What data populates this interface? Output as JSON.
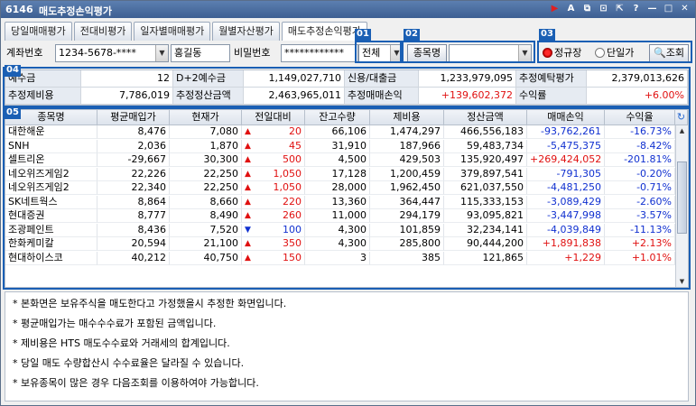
{
  "window": {
    "screen_no": "6146",
    "title": "매도추정손익평가"
  },
  "title_buttons": [
    "play-icon",
    "font-icon",
    "copy-icon",
    "link-icon",
    "export-icon",
    "help-icon",
    "minimize-icon",
    "maximize-icon",
    "close-icon"
  ],
  "tabs": [
    {
      "label": "당일매매평가",
      "active": false
    },
    {
      "label": "전대비평가",
      "active": false
    },
    {
      "label": "일자별매매평가",
      "active": false
    },
    {
      "label": "월별자산평가",
      "active": false
    },
    {
      "label": "매도추정손익평가",
      "active": true
    }
  ],
  "form": {
    "account_label": "계좌번호",
    "account_value": "1234-5678-****",
    "account_name": "홍길동",
    "password_label": "비밀번호",
    "password_value": "************",
    "filter_value": "전체",
    "stock_button": "종목명",
    "stock_value": "",
    "radio_regular": "정규장",
    "radio_single": "단일가",
    "query_button": "조회"
  },
  "badges": [
    "01",
    "02",
    "03",
    "04",
    "05"
  ],
  "summary": {
    "row1": [
      {
        "label": "예수금",
        "value": "12"
      },
      {
        "label": "D+2예수금",
        "value": "1,149,027,710"
      },
      {
        "label": "신용/대출금",
        "value": "1,233,979,095"
      },
      {
        "label": "추정예탁평가",
        "value": "2,379,013,626"
      }
    ],
    "row2": [
      {
        "label": "추정제비용",
        "value": "7,786,019"
      },
      {
        "label": "추정정산금액",
        "value": "2,463,965,011"
      },
      {
        "label": "추정매매손익",
        "value": "+139,602,372"
      },
      {
        "label": "수익률",
        "value": "+6.00%"
      }
    ]
  },
  "table": {
    "headers": [
      "종목명",
      "평균매입가",
      "현재가",
      "전일대비",
      "잔고수량",
      "제비용",
      "정산금액",
      "매매손익",
      "수익율"
    ],
    "rows": [
      {
        "name": "대한해운",
        "avg": "8,476",
        "price": "7,080",
        "dir": "up",
        "chg": "20",
        "qty": "66,106",
        "cost": "1,474,297",
        "settle": "466,556,183",
        "pl": "-93,762,261",
        "rate": "-16.73%"
      },
      {
        "name": "SNH",
        "avg": "2,036",
        "price": "1,870",
        "dir": "up",
        "chg": "45",
        "qty": "31,910",
        "cost": "187,966",
        "settle": "59,483,734",
        "pl": "-5,475,375",
        "rate": "-8.42%"
      },
      {
        "name": "셀트리온",
        "avg": "-29,667",
        "price": "30,300",
        "dir": "up",
        "chg": "500",
        "qty": "4,500",
        "cost": "429,503",
        "settle": "135,920,497",
        "pl": "+269,424,052",
        "rate": "-201.81%"
      },
      {
        "name": "네오위즈게임2",
        "avg": "22,226",
        "price": "22,250",
        "dir": "up",
        "chg": "1,050",
        "qty": "17,128",
        "cost": "1,200,459",
        "settle": "379,897,541",
        "pl": "-791,305",
        "rate": "-0.20%"
      },
      {
        "name": "네오위즈게임2",
        "avg": "22,340",
        "price": "22,250",
        "dir": "up",
        "chg": "1,050",
        "qty": "28,000",
        "cost": "1,962,450",
        "settle": "621,037,550",
        "pl": "-4,481,250",
        "rate": "-0.71%"
      },
      {
        "name": "SK네트웍스",
        "avg": "8,864",
        "price": "8,660",
        "dir": "up",
        "chg": "220",
        "qty": "13,360",
        "cost": "364,447",
        "settle": "115,333,153",
        "pl": "-3,089,429",
        "rate": "-2.60%"
      },
      {
        "name": "현대증권",
        "avg": "8,777",
        "price": "8,490",
        "dir": "up",
        "chg": "260",
        "qty": "11,000",
        "cost": "294,179",
        "settle": "93,095,821",
        "pl": "-3,447,998",
        "rate": "-3.57%"
      },
      {
        "name": "조광페인트",
        "avg": "8,436",
        "price": "7,520",
        "dir": "down",
        "chg": "100",
        "qty": "4,300",
        "cost": "101,859",
        "settle": "32,234,141",
        "pl": "-4,039,849",
        "rate": "-11.13%"
      },
      {
        "name": "한화케미칼",
        "avg": "20,594",
        "price": "21,100",
        "dir": "up",
        "chg": "350",
        "qty": "4,300",
        "cost": "285,800",
        "settle": "90,444,200",
        "pl": "+1,891,838",
        "rate": "+2.13%"
      },
      {
        "name": "현대하이스코",
        "avg": "40,212",
        "price": "40,750",
        "dir": "up",
        "chg": "150",
        "qty": "3",
        "cost": "385",
        "settle": "121,865",
        "pl": "+1,229",
        "rate": "+1.01%"
      }
    ]
  },
  "notes": [
    "* 본화면은 보유주식을 매도한다고 가정했을시 추정한 화면입니다.",
    "* 평균매입가는 매수수수료가 포함된 금액입니다.",
    "* 제비용은 HTS 매도수수료와 거래세의 합계입니다.",
    "* 당일 매도 수량합산시 수수료율은 달라질 수 있습니다.",
    "* 보유종목이 많은 경우 다음조회를 이용하여야 가능합니다."
  ],
  "colors": {
    "up": "#e01010",
    "down": "#1030d0",
    "badge": "#1a5fb4",
    "titlebar": "#3d5f92"
  }
}
